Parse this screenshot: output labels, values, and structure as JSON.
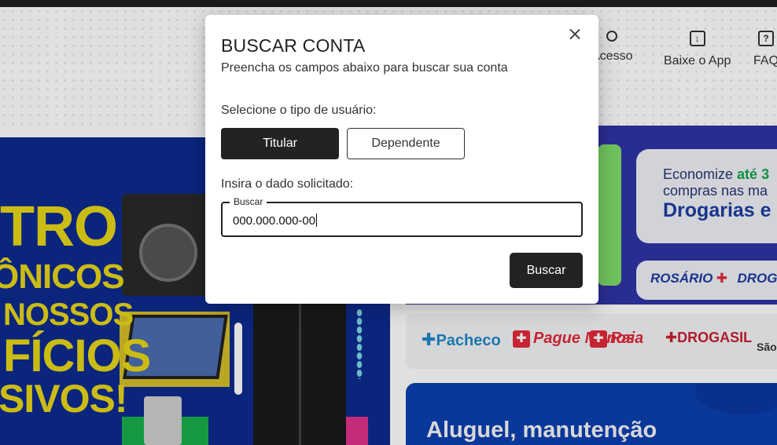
{
  "header": {
    "items": [
      {
        "label": "Acesso",
        "icon": "person-icon"
      },
      {
        "label": "Baixe o App",
        "icon": "download-icon"
      },
      {
        "label": "FAQ",
        "icon": "help-icon"
      }
    ]
  },
  "banner_left": {
    "lines": [
      "TRO",
      "ÔNICOS",
      "NOSSOS",
      "FÍCIOS",
      "SIVOS!"
    ]
  },
  "banner_right": {
    "line1_prefix": "Economize ",
    "line1_highlight": "até 3",
    "line2": "compras nas ma",
    "line3": "Drogarias e N",
    "partner1": "ROSÁRIO",
    "partner2": "DROGA"
  },
  "pharmacies": [
    {
      "name": "Pacheco",
      "color": "#1e88c8"
    },
    {
      "name": "Pague Menos",
      "color": "#e2293a"
    },
    {
      "name": "Raia",
      "color": "#e2293a"
    },
    {
      "name": "DROGASIL",
      "color": "#c8202f"
    },
    {
      "name": "São",
      "color": "#333333"
    }
  ],
  "bottom_banner": {
    "text": "Aluguel, manutenção"
  },
  "modal": {
    "title": "BUSCAR CONTA",
    "subtitle": "Preencha os campos abaixo para buscar sua conta",
    "user_type_label": "Selecione o tipo de usuário:",
    "user_types": {
      "titular": "Titular",
      "dependente": "Dependente"
    },
    "selected_user_type": "Titular",
    "data_label": "Insira o dado solicitado:",
    "search_field": {
      "legend": "Buscar",
      "value": "000.000.000-00"
    },
    "submit_label": "Buscar"
  },
  "colors": {
    "primary_dark": "#232323",
    "banner_blue": "#0d2b8f",
    "banner_yellow": "#e8d617"
  }
}
